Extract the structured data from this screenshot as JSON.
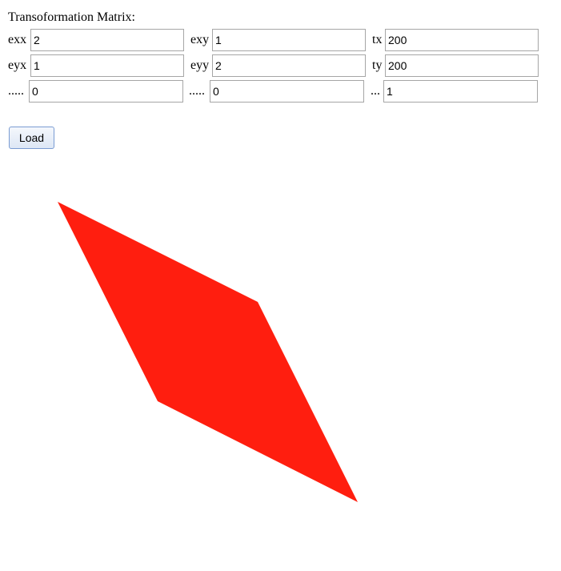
{
  "title": "Transoformation Matrix:",
  "matrix": {
    "row1": [
      {
        "label": "exx",
        "value": "2"
      },
      {
        "label": "exy",
        "value": "1"
      },
      {
        "label": "tx",
        "value": "200"
      }
    ],
    "row2": [
      {
        "label": "eyx",
        "value": "1"
      },
      {
        "label": "eyy",
        "value": "2"
      },
      {
        "label": "ty",
        "value": "200"
      }
    ],
    "row3": [
      {
        "label": ".....",
        "value": "0"
      },
      {
        "label": ".....",
        "value": "0"
      },
      {
        "label": "...",
        "value": "1"
      }
    ]
  },
  "load_label": "Load",
  "shape": {
    "fill": "#ff1e0f"
  }
}
